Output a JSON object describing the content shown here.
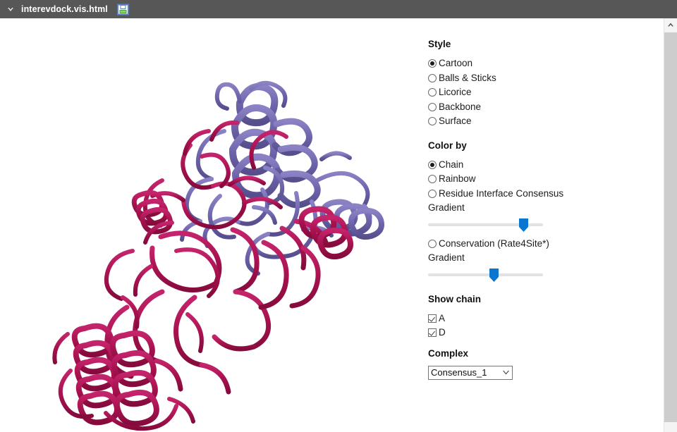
{
  "titlebar": {
    "filename": "interevdock.vis.html",
    "collapse_icon": "chevron-down-icon",
    "save_icon": "floppy-disk-save-icon"
  },
  "scrollbar": {
    "up_arrow_icon": "chevron-up-icon"
  },
  "viewer": {
    "representation": "cartoon",
    "chain_colors": {
      "A": "#A8124F",
      "D": "#6D64AB"
    },
    "background": "#ffffff"
  },
  "panel": {
    "style": {
      "title": "Style",
      "options": [
        {
          "label": "Cartoon",
          "selected": true
        },
        {
          "label": "Balls & Sticks",
          "selected": false
        },
        {
          "label": "Licorice",
          "selected": false
        },
        {
          "label": "Backbone",
          "selected": false
        },
        {
          "label": "Surface",
          "selected": false
        }
      ]
    },
    "color_by": {
      "title": "Color by",
      "options": [
        {
          "label": "Chain",
          "selected": true
        },
        {
          "label": "Rainbow",
          "selected": false
        },
        {
          "label": "Residue Interface Consensus",
          "selected": false
        },
        {
          "label": "Conservation (Rate4Site*)",
          "selected": false
        }
      ],
      "consensus_gradient_label": "Gradient",
      "consensus_gradient_value": 83,
      "conservation_gradient_label": "Gradient",
      "conservation_gradient_value": 57,
      "slider_color": "#0a76d0"
    },
    "show_chain": {
      "title": "Show chain",
      "chains": [
        {
          "label": "A",
          "checked": true
        },
        {
          "label": "D",
          "checked": true
        }
      ]
    },
    "complex": {
      "title": "Complex",
      "selected": "Consensus_1",
      "dropdown_icon": "chevron-down-icon"
    }
  }
}
